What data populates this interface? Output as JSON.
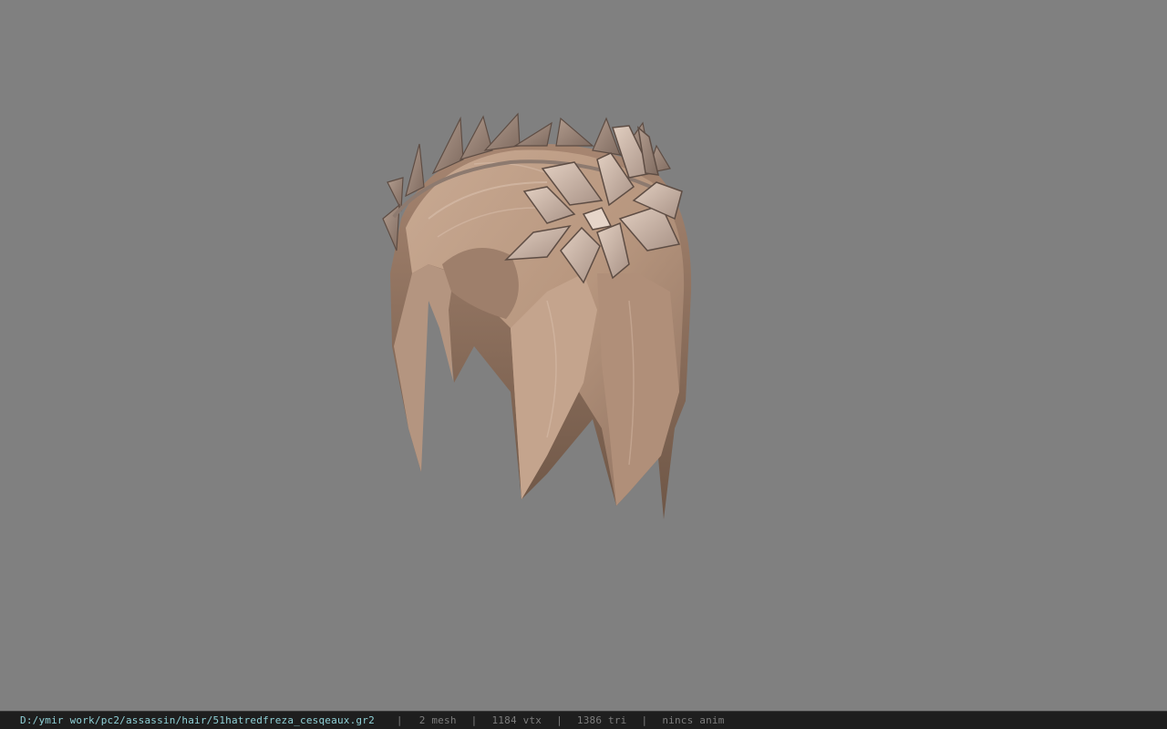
{
  "viewport": {
    "background": "#808080",
    "model_description_icon": "hair-mesh-with-leaf-crown"
  },
  "status": {
    "file_path": "D:/ymir work/pc2/assassin/hair/51hatredfreza_cesqeaux.gr2",
    "separator": "|",
    "mesh": "2 mesh",
    "vtx": "1184 vtx",
    "tri": "1386 tri",
    "anim": "nincs anim"
  },
  "colors": {
    "path": "#8fd0d6",
    "stats": "#7d7d7d",
    "statusbar_bg": "#1e1e1e"
  }
}
